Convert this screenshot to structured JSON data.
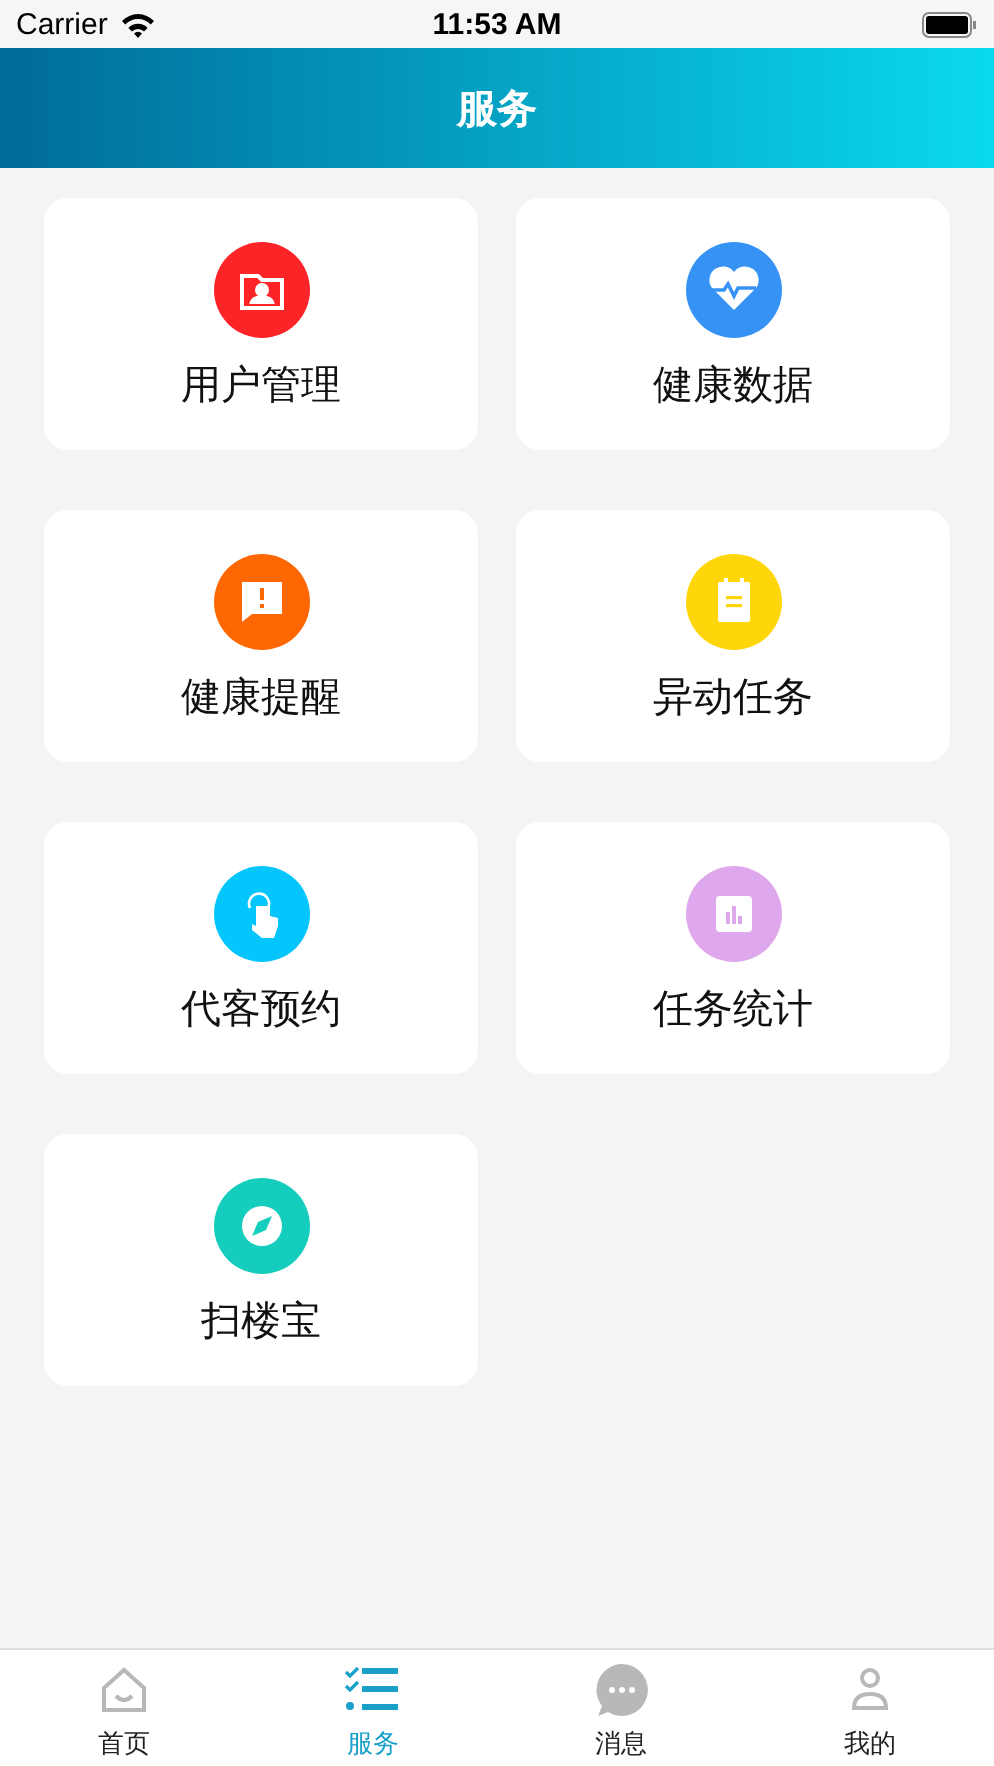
{
  "status_bar": {
    "carrier": "Carrier",
    "time": "11:53 AM"
  },
  "header": {
    "title": "服务"
  },
  "services": [
    {
      "label": "用户管理",
      "color": "#fd2428"
    },
    {
      "label": "健康数据",
      "color": "#3792f5"
    },
    {
      "label": "健康提醒",
      "color": "#fe6702"
    },
    {
      "label": "异动任务",
      "color": "#ffd60a"
    },
    {
      "label": "代客预约",
      "color": "#04c6fc"
    },
    {
      "label": "任务统计",
      "color": "#e0a8ec"
    },
    {
      "label": "扫楼宝",
      "color": "#14cdbc"
    }
  ],
  "tab_bar": [
    {
      "label": "首页",
      "selected": false
    },
    {
      "label": "服务",
      "selected": true
    },
    {
      "label": "消息",
      "selected": false
    },
    {
      "label": "我的",
      "selected": false
    }
  ]
}
